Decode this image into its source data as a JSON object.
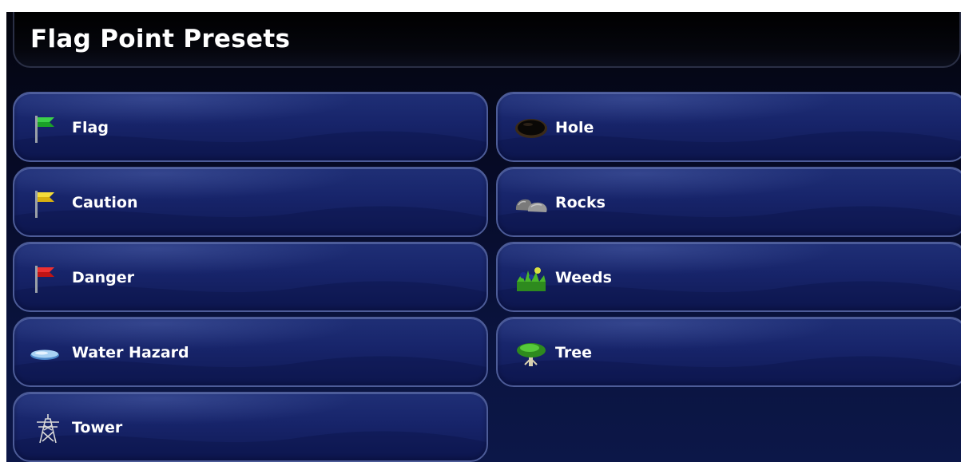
{
  "header": {
    "title": "Flag Point Presets"
  },
  "presets": {
    "left": [
      {
        "label": "Flag",
        "icon": "green-flag-icon",
        "color": "#1aa028"
      },
      {
        "label": "Caution",
        "icon": "yellow-flag-icon",
        "color": "#e8c81a"
      },
      {
        "label": "Danger",
        "icon": "red-flag-icon",
        "color": "#d81e1e"
      },
      {
        "label": "Water Hazard",
        "icon": "water-hazard-icon",
        "color": "#7fb3e6"
      },
      {
        "label": "Tower",
        "icon": "tower-icon",
        "color": "#c8c8c8"
      }
    ],
    "right": [
      {
        "label": "Hole",
        "icon": "hole-icon",
        "color": "#1a1208"
      },
      {
        "label": "Rocks",
        "icon": "rocks-icon",
        "color": "#8a8a8a"
      },
      {
        "label": "Weeds",
        "icon": "weeds-icon",
        "color": "#4aa02a"
      },
      {
        "label": "Tree",
        "icon": "tree-icon",
        "color": "#3a9a2a"
      }
    ]
  },
  "theme": {
    "background": "#0a1440",
    "button_fill": "#17246a",
    "button_border": "#4d5c98",
    "text": "#ffffff"
  }
}
